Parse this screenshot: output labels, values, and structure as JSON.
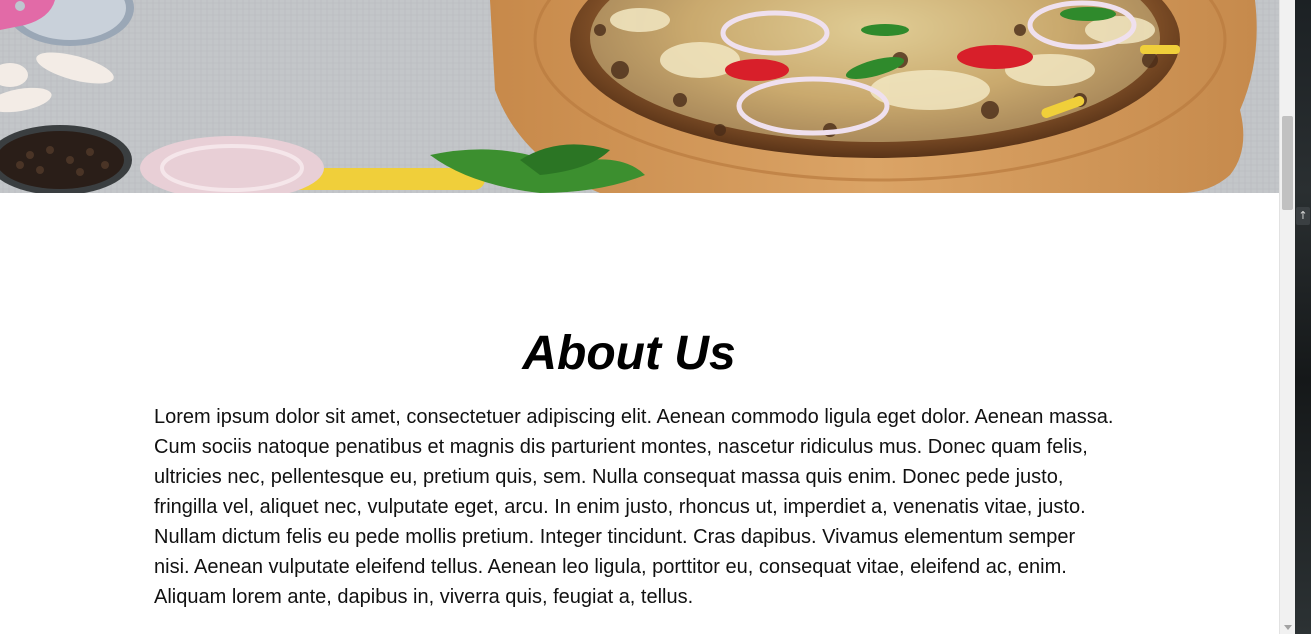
{
  "about": {
    "title": "About Us",
    "body": "Lorem ipsum dolor sit amet, consectetuer adipiscing elit. Aenean commodo ligula eget dolor. Aenean massa. Cum sociis natoque penatibus et magnis dis parturient montes, nascetur ridiculus mus. Donec quam felis, ultricies nec, pellentesque eu, pretium quis, sem. Nulla consequat massa quis enim. Donec pede justo, fringilla vel, aliquet nec, vulputate eget, arcu. In enim justo, rhoncus ut, imperdiet a, venenatis vitae, justo. Nullam dictum felis eu pede mollis pretium. Integer tincidunt. Cras dapibus. Vivamus elementum semper nisi. Aenean vulputate eleifend tellus. Aenean leo ligula, porttitor eu, consequat vitae, eleifend ac, enim. Aliquam lorem ante, dapibus in, viverra quis, feugiat a, tellus."
  },
  "hero": {
    "image": "pizza-banner-image"
  },
  "side_panel": {
    "icon": "arrow-up-icon",
    "glyph": "↑"
  },
  "colors": {
    "text": "#000000",
    "background": "#ffffff",
    "table_surface": "#c4c7ca",
    "wood_board": "#d39a55"
  }
}
